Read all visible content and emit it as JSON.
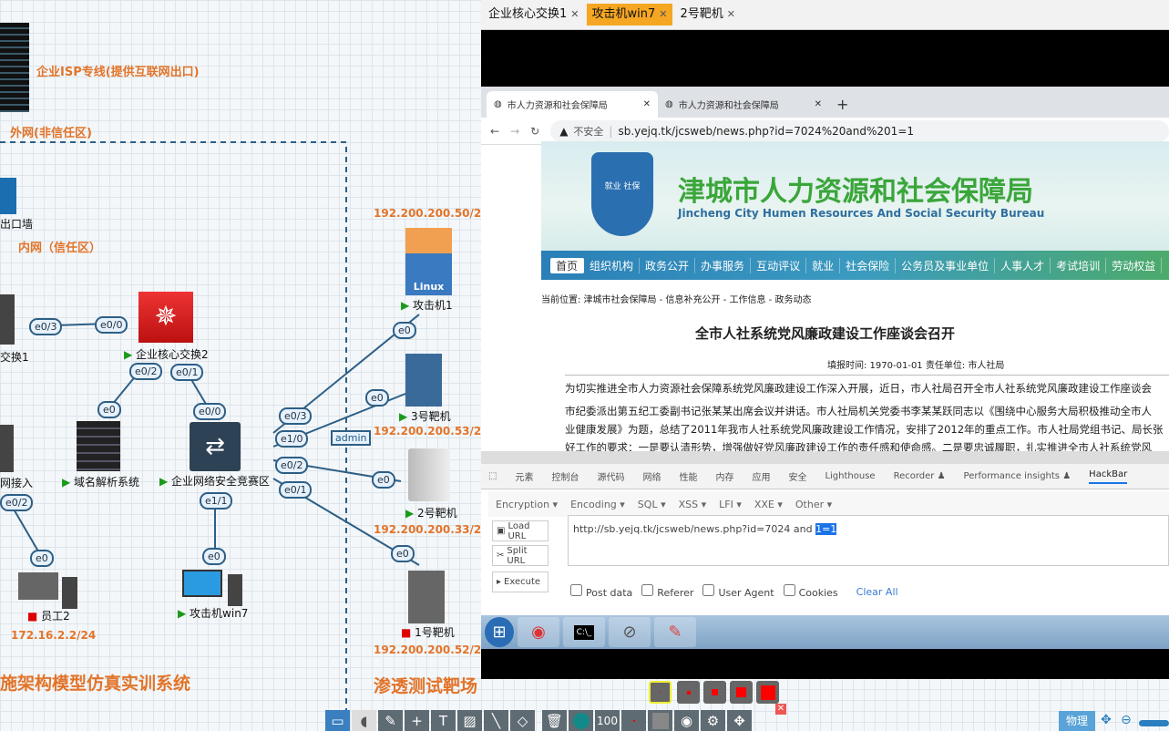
{
  "diagram": {
    "isp_label": "企业ISP专线(提供互联网出口)",
    "outer_zone": "外网(非信任区)",
    "inner_zone": "内网（信任区）",
    "firewall_label": "出口墙",
    "switch1_label": "交换1",
    "access_label": "网接入",
    "core_switch2": "企业核心交换2",
    "dns_label": "域名解析系统",
    "security_zone": "企业网络安全竞赛区",
    "attacker1": "攻击机1",
    "attacker1_ip": "192.200.200.50/24",
    "target3": "3号靶机",
    "target3_ip": "192.200.200.53/24",
    "target2": "2号靶机",
    "target2_ip": "192.200.200.33/24",
    "target1": "1号靶机",
    "target1_ip": "192.200.200.52/24",
    "employee2": "员工2",
    "employee2_ip": "172.16.2.2/24",
    "attacker_win7": "攻击机win7",
    "admin": "admin",
    "system_title": "施架构模型仿真实训系统",
    "range_title": "渗透测试靶场",
    "ports": {
      "p_e03": "e0/3",
      "p_e00": "e0/0",
      "p_e02a": "e0/2",
      "p_e01a": "e0/1",
      "p_e0_dns": "e0",
      "p_e00b": "e0/0",
      "p_e03b": "e0/3",
      "p_e10": "e1/0",
      "p_e02b": "e0/2",
      "p_e01b": "e0/1",
      "p_e11": "e1/1",
      "p_e0_win7": "e0",
      "p_e0_att1": "e0",
      "p_e0_t3": "e0",
      "p_e0_t2": "e0",
      "p_e0_t1": "e0",
      "p_e02c": "e0/2",
      "p_e0_emp": "e0"
    }
  },
  "remote": {
    "tabs": [
      {
        "label": "企业核心交换1"
      },
      {
        "label": "攻击机win7",
        "active": true
      },
      {
        "label": "2号靶机"
      }
    ],
    "browser": {
      "tabs": [
        {
          "label": "市人力资源和社会保障局"
        },
        {
          "label": "市人力资源和社会保障局"
        }
      ],
      "insecure": "不安全",
      "url": "sb.yejq.tk/jcsweb/news.php?id=7024%20and%201=1"
    },
    "site": {
      "title_cn": "津城市人力资源和社会保障局",
      "title_en": "Jincheng City Humen Resources And Social Security Bureau",
      "logo_text": "就业 社保",
      "nav": [
        "首页",
        "组织机构",
        "政务公开",
        "办事服务",
        "互动评议",
        "就业",
        "社会保险",
        "公务员及事业单位",
        "人事人才",
        "考试培训",
        "劳动权益"
      ],
      "breadcrumb": "当前位置: 津城市社会保障局 - 信息补充公开 - 工作信息 - 政务动态",
      "article_title": "全市人社系统党风廉政建设工作座谈会召开",
      "meta": "填报时间:   1970-01-01   责任单位:   市人社局",
      "paragraphs": [
        "为切实推进全市人力资源社会保障系统党风廉政建设工作深入开展，近日，市人社局召开全市人社系统党风廉政建设工作座谈会",
        "市纪委派出第五纪工委副书记张某某出席会议并讲话。市人社局机关党委书李某某跃同志以《围绕中心服务大局积极推动全市人",
        "业健康发展》为题，总结了2011年我市人社系统党风廉政建设工作情况，安排了2012年的重点工作。市人社局党组书记、局长张",
        "好工作的要求：一是要认清形势，增强做好党风廉政建设工作的责任感和使命感。二是要忠诚履职，扎实推进全市人社系统党风"
      ]
    },
    "devtools": {
      "tabs": [
        "元素",
        "控制台",
        "源代码",
        "网络",
        "性能",
        "内存",
        "应用",
        "安全",
        "Lighthouse",
        "Recorder ♟",
        "Performance insights ♟",
        "HackBar"
      ]
    },
    "hackbar": {
      "menus": [
        "Encryption ▾",
        "Encoding ▾",
        "SQL ▾",
        "XSS ▾",
        "LFI ▾",
        "XXE ▾",
        "Other ▾"
      ],
      "load_url": "Load URL",
      "split_url": "Split URL",
      "execute": "Execute",
      "url_text": "http://sb.yejq.tk/jcsweb/news.php?id=7024 and ",
      "url_selected": "1=1",
      "checks": [
        "Post data",
        "Referer",
        "User Agent",
        "Cookies"
      ],
      "clear_all": "Clear All"
    }
  },
  "toolbar": {
    "zoom_value": "100",
    "mode_button": "物理"
  }
}
